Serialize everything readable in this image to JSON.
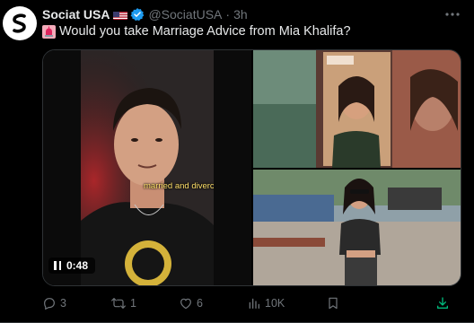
{
  "tweet": {
    "author_name": "Sociat USA",
    "handle": "@SociatUSA",
    "separator": "·",
    "time": "3h",
    "text": "Would you take Marriage Advice from Mia Khalifa?"
  },
  "media": {
    "video_caption": "married and diverced",
    "video_duration": "0:48"
  },
  "actions": {
    "replies": "3",
    "reposts": "1",
    "likes": "6",
    "views": "10K"
  },
  "colors": {
    "background": "#000000",
    "text_primary": "#e7e9ea",
    "text_secondary": "#71767b",
    "verified": "#1d9bf0",
    "share_accent": "#00ba7c"
  },
  "icons": {
    "avatar": "sociat-logo",
    "verified": "verified-badge-icon",
    "more": "more-icon",
    "siren": "siren-emoji",
    "flag": "us-flag-emoji",
    "pause": "pause-icon",
    "reply": "reply-icon",
    "repost": "repost-icon",
    "like": "heart-icon",
    "views": "views-icon",
    "bookmark": "bookmark-icon",
    "share": "share-icon"
  }
}
